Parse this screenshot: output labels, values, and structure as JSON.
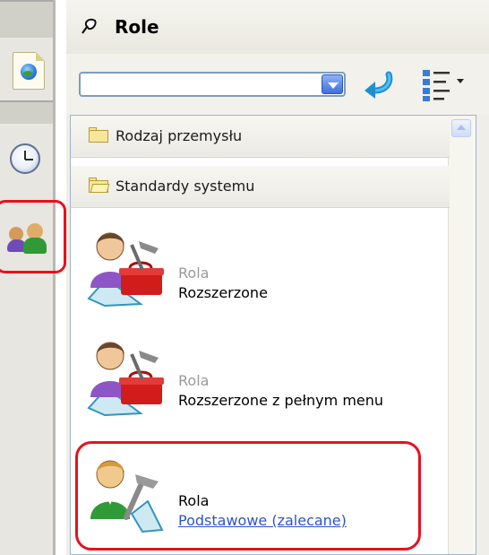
{
  "colors": {
    "highlight": "#e8101d",
    "link": "#2d55c8",
    "panel_background": "#efeee8",
    "toolbar_strip": "#e7e6e0"
  },
  "sidebar": {
    "icons": [
      "document-globe-icon",
      "clock-icon",
      "users-icon"
    ],
    "selected": "users-icon"
  },
  "header": {
    "title": "Role",
    "icon": "pin-icon"
  },
  "toolbar": {
    "combo_value": "",
    "combo_placeholder": "",
    "go_icon": "go-arrow-icon",
    "view_icon": "list-view-icon"
  },
  "list": {
    "groups": [
      {
        "label": "Rodzaj przemysłu",
        "state": "collapsed"
      },
      {
        "label": "Standardy systemu",
        "state": "expanded"
      }
    ],
    "roles": [
      {
        "kicker": "Rola",
        "name": "Rozszerzone",
        "icon": "role-extended-icon"
      },
      {
        "kicker": "Rola",
        "name": "Rozszerzone z pełnym menu",
        "icon": "role-extended-full-icon"
      },
      {
        "kicker": "Rola",
        "name": "Podstawowe (zalecane)",
        "icon": "role-basic-icon",
        "link": true
      }
    ]
  }
}
